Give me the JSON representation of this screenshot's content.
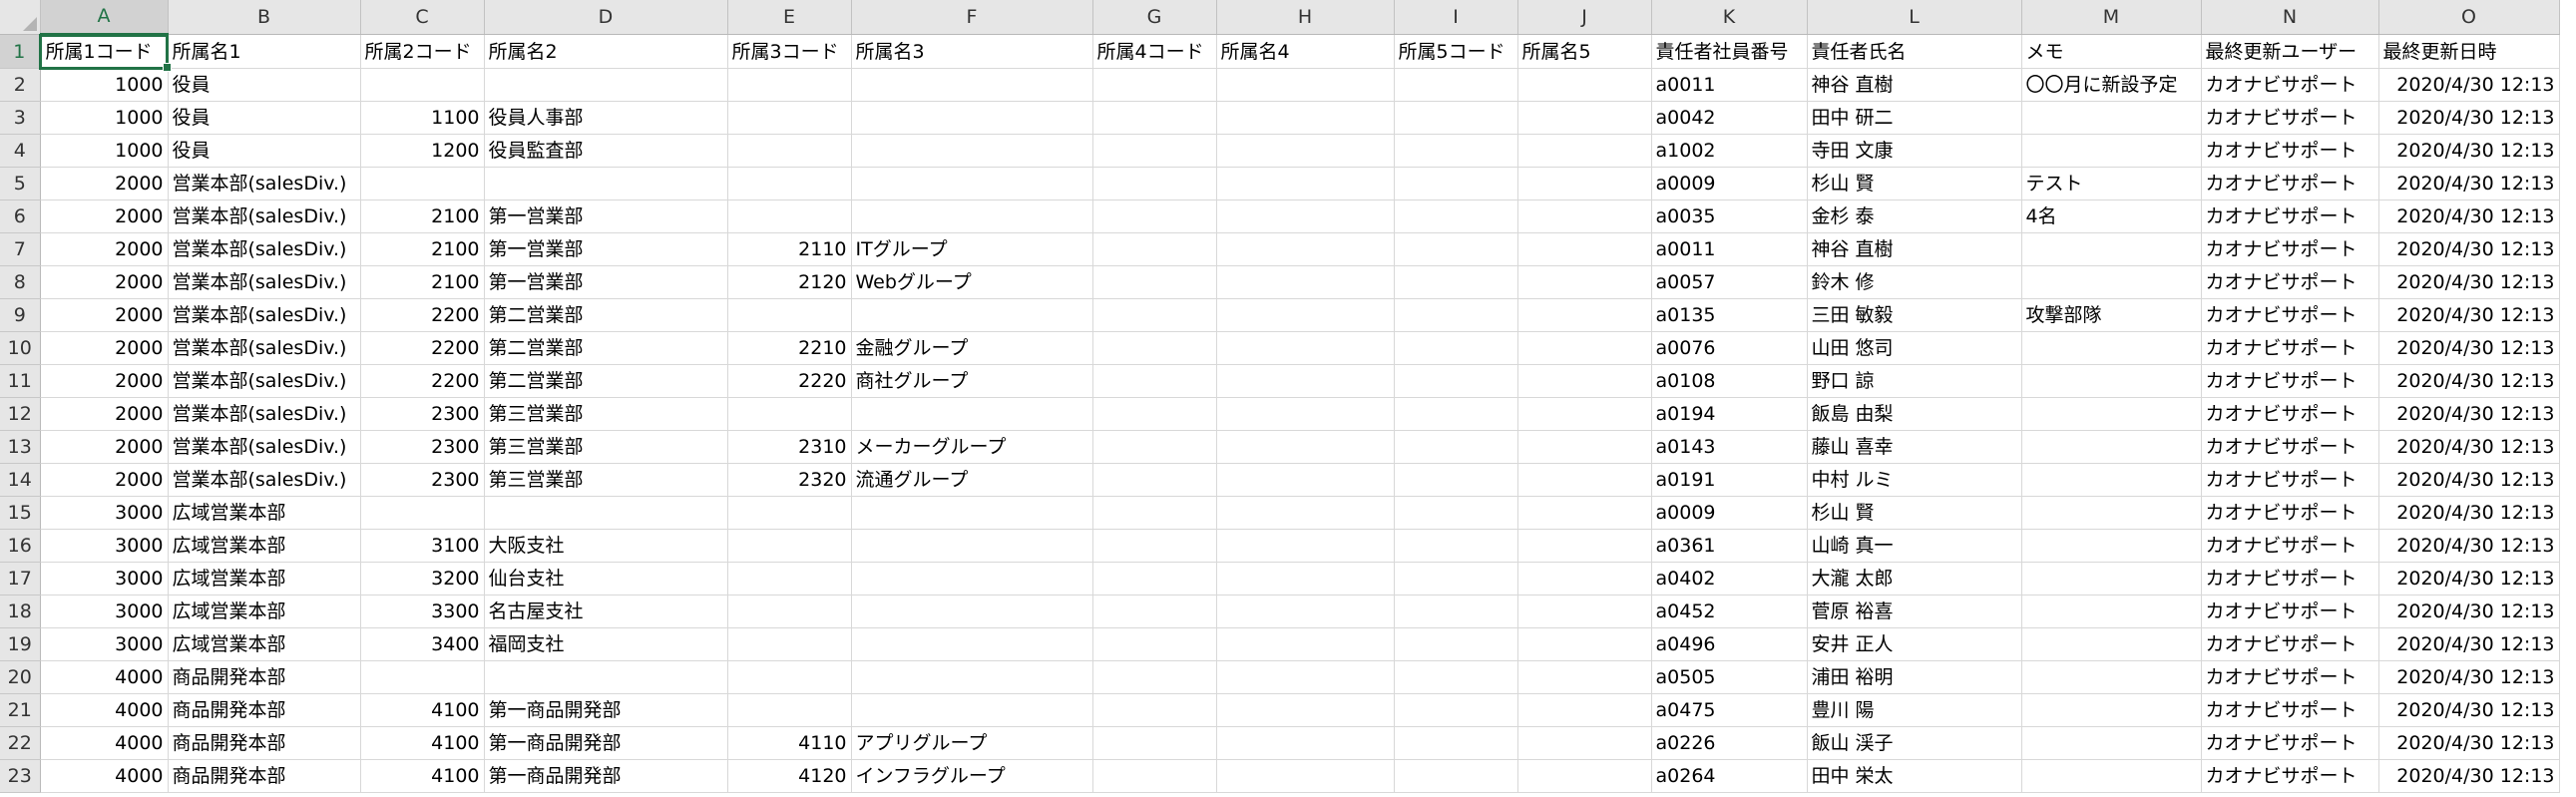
{
  "sheet": {
    "columns": [
      "A",
      "B",
      "C",
      "D",
      "E",
      "F",
      "G",
      "H",
      "I",
      "J",
      "K",
      "L",
      "M",
      "N",
      "O"
    ],
    "selected_cell": "A1",
    "rows": [
      [
        "所属1コード",
        "所属名1",
        "所属2コード",
        "所属名2",
        "所属3コード",
        "所属名3",
        "所属4コード",
        "所属名4",
        "所属5コード",
        "所属名5",
        "責任者社員番号",
        "責任者氏名",
        "メモ",
        "最終更新ユーザー",
        "最終更新日時"
      ],
      [
        "1000",
        "役員",
        "",
        "",
        "",
        "",
        "",
        "",
        "",
        "",
        "a0011",
        "神谷 直樹",
        "〇〇月に新設予定",
        "カオナビサポート",
        "2020/4/30 12:13"
      ],
      [
        "1000",
        "役員",
        "1100",
        "役員人事部",
        "",
        "",
        "",
        "",
        "",
        "",
        "a0042",
        "田中 研二",
        "",
        "カオナビサポート",
        "2020/4/30 12:13"
      ],
      [
        "1000",
        "役員",
        "1200",
        "役員監査部",
        "",
        "",
        "",
        "",
        "",
        "",
        "a1002",
        "寺田 文康",
        "",
        "カオナビサポート",
        "2020/4/30 12:13"
      ],
      [
        "2000",
        "営業本部(salesDiv.)",
        "",
        "",
        "",
        "",
        "",
        "",
        "",
        "",
        "a0009",
        "杉山 賢",
        "テスト",
        "カオナビサポート",
        "2020/4/30 12:13"
      ],
      [
        "2000",
        "営業本部(salesDiv.)",
        "2100",
        "第一営業部",
        "",
        "",
        "",
        "",
        "",
        "",
        "a0035",
        "金杉 泰",
        "4名",
        "カオナビサポート",
        "2020/4/30 12:13"
      ],
      [
        "2000",
        "営業本部(salesDiv.)",
        "2100",
        "第一営業部",
        "2110",
        "ITグループ",
        "",
        "",
        "",
        "",
        "a0011",
        "神谷 直樹",
        "",
        "カオナビサポート",
        "2020/4/30 12:13"
      ],
      [
        "2000",
        "営業本部(salesDiv.)",
        "2100",
        "第一営業部",
        "2120",
        "Webグループ",
        "",
        "",
        "",
        "",
        "a0057",
        "鈴木 修",
        "",
        "カオナビサポート",
        "2020/4/30 12:13"
      ],
      [
        "2000",
        "営業本部(salesDiv.)",
        "2200",
        "第二営業部",
        "",
        "",
        "",
        "",
        "",
        "",
        "a0135",
        "三田 敏毅",
        "攻撃部隊",
        "カオナビサポート",
        "2020/4/30 12:13"
      ],
      [
        "2000",
        "営業本部(salesDiv.)",
        "2200",
        "第二営業部",
        "2210",
        "金融グループ",
        "",
        "",
        "",
        "",
        "a0076",
        "山田 悠司",
        "",
        "カオナビサポート",
        "2020/4/30 12:13"
      ],
      [
        "2000",
        "営業本部(salesDiv.)",
        "2200",
        "第二営業部",
        "2220",
        "商社グループ",
        "",
        "",
        "",
        "",
        "a0108",
        "野口 諒",
        "",
        "カオナビサポート",
        "2020/4/30 12:13"
      ],
      [
        "2000",
        "営業本部(salesDiv.)",
        "2300",
        "第三営業部",
        "",
        "",
        "",
        "",
        "",
        "",
        "a0194",
        "飯島 由梨",
        "",
        "カオナビサポート",
        "2020/4/30 12:13"
      ],
      [
        "2000",
        "営業本部(salesDiv.)",
        "2300",
        "第三営業部",
        "2310",
        "メーカーグループ",
        "",
        "",
        "",
        "",
        "a0143",
        "藤山 喜幸",
        "",
        "カオナビサポート",
        "2020/4/30 12:13"
      ],
      [
        "2000",
        "営業本部(salesDiv.)",
        "2300",
        "第三営業部",
        "2320",
        "流通グループ",
        "",
        "",
        "",
        "",
        "a0191",
        "中村 ルミ",
        "",
        "カオナビサポート",
        "2020/4/30 12:13"
      ],
      [
        "3000",
        "広域営業本部",
        "",
        "",
        "",
        "",
        "",
        "",
        "",
        "",
        "a0009",
        "杉山 賢",
        "",
        "カオナビサポート",
        "2020/4/30 12:13"
      ],
      [
        "3000",
        "広域営業本部",
        "3100",
        "大阪支社",
        "",
        "",
        "",
        "",
        "",
        "",
        "a0361",
        "山崎 真一",
        "",
        "カオナビサポート",
        "2020/4/30 12:13"
      ],
      [
        "3000",
        "広域営業本部",
        "3200",
        "仙台支社",
        "",
        "",
        "",
        "",
        "",
        "",
        "a0402",
        "大瀧 太郎",
        "",
        "カオナビサポート",
        "2020/4/30 12:13"
      ],
      [
        "3000",
        "広域営業本部",
        "3300",
        "名古屋支社",
        "",
        "",
        "",
        "",
        "",
        "",
        "a0452",
        "菅原 裕喜",
        "",
        "カオナビサポート",
        "2020/4/30 12:13"
      ],
      [
        "3000",
        "広域営業本部",
        "3400",
        "福岡支社",
        "",
        "",
        "",
        "",
        "",
        "",
        "a0496",
        "安井 正人",
        "",
        "カオナビサポート",
        "2020/4/30 12:13"
      ],
      [
        "4000",
        "商品開発本部",
        "",
        "",
        "",
        "",
        "",
        "",
        "",
        "",
        "a0505",
        "浦田 裕明",
        "",
        "カオナビサポート",
        "2020/4/30 12:13"
      ],
      [
        "4000",
        "商品開発本部",
        "4100",
        "第一商品開発部",
        "",
        "",
        "",
        "",
        "",
        "",
        "a0475",
        "豊川 陽",
        "",
        "カオナビサポート",
        "2020/4/30 12:13"
      ],
      [
        "4000",
        "商品開発本部",
        "4100",
        "第一商品開発部",
        "4110",
        "アプリグループ",
        "",
        "",
        "",
        "",
        "a0226",
        "飯山 渓子",
        "",
        "カオナビサポート",
        "2020/4/30 12:13"
      ],
      [
        "4000",
        "商品開発本部",
        "4100",
        "第一商品開発部",
        "4120",
        "インフラグループ",
        "",
        "",
        "",
        "",
        "a0264",
        "田中 栄太",
        "",
        "カオナビサポート",
        "2020/4/30 12:13"
      ]
    ]
  }
}
